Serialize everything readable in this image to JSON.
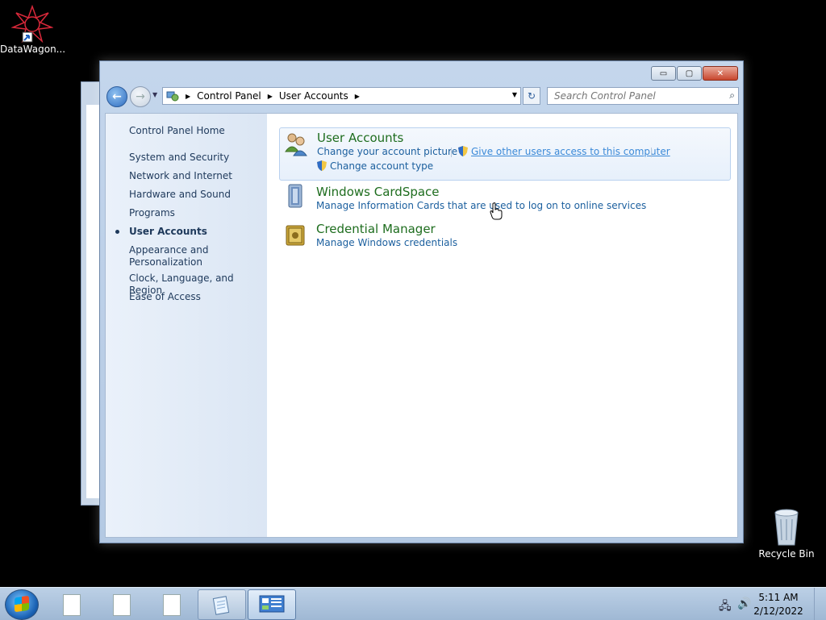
{
  "desktop": {
    "icons": [
      {
        "label": "DataWagon..."
      },
      {
        "label": "Recycle Bin"
      }
    ]
  },
  "window": {
    "controls": {
      "minimize": "▭",
      "maximize": "▢",
      "close": "✕"
    },
    "nav": {
      "breadcrumb": [
        "Control Panel",
        "User Accounts"
      ],
      "search_placeholder": "Search Control Panel"
    },
    "left_pane": {
      "items": [
        {
          "label": "Control Panel Home",
          "active": false
        },
        {
          "label": "System and Security",
          "active": false
        },
        {
          "label": "Network and Internet",
          "active": false
        },
        {
          "label": "Hardware and Sound",
          "active": false
        },
        {
          "label": "Programs",
          "active": false
        },
        {
          "label": "User Accounts",
          "active": true
        },
        {
          "label": "Appearance and",
          "label2": "Personalization",
          "active": false
        },
        {
          "label": "Clock, Language, and Region",
          "active": false
        },
        {
          "label": "Ease of Access",
          "active": false
        }
      ]
    },
    "categories": [
      {
        "title": "User Accounts",
        "links": [
          "Change your account picture",
          "Give other users access to this computer",
          "Change account type"
        ]
      },
      {
        "title": "Windows CardSpace",
        "links": [
          "Manage Information Cards that are used to log on to online services"
        ]
      },
      {
        "title": "Credential Manager",
        "links": [
          "Manage Windows credentials"
        ]
      }
    ]
  },
  "taskbar": {
    "clock_time": "5:11 AM",
    "clock_date": "2/12/2022"
  },
  "colors": {
    "link": "#1b5f9e",
    "category_title": "#1e6d1e",
    "left_pane_text": "#1e395b"
  }
}
